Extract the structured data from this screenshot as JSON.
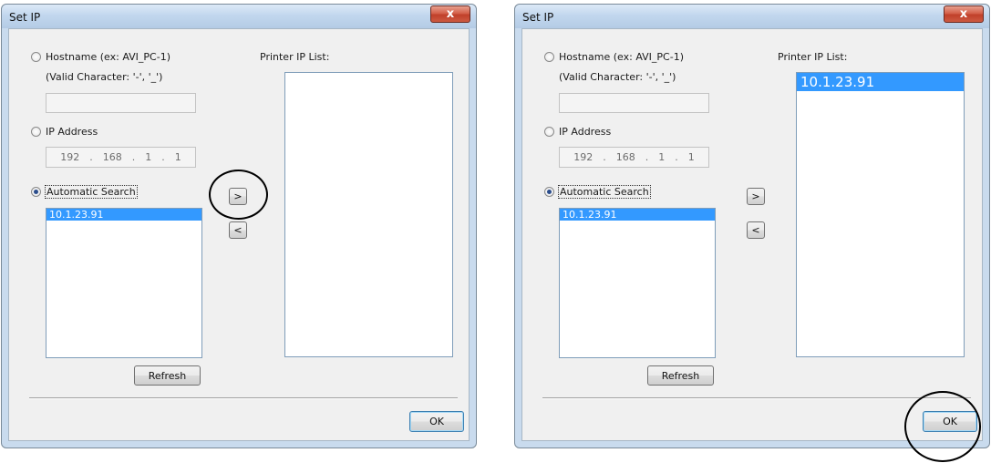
{
  "dialog": {
    "title": "Set IP",
    "close_label": "x",
    "hostname_radio_label": "Hostname (ex: AVI_PC-1)",
    "valid_chars_label": "(Valid Character: '-', '_')",
    "ip_radio_label": "IP Address",
    "ip_octets": [
      "192",
      "168",
      "1",
      "1"
    ],
    "ip_separator": ".",
    "auto_search_label": "Automatic Search",
    "printer_list_label": "Printer IP List:",
    "add_button": ">",
    "remove_button": "<",
    "refresh_button": "Refresh",
    "ok_button": "OK"
  },
  "before": {
    "search_results": [
      "10.1.23.91"
    ],
    "printer_ip_list": []
  },
  "after": {
    "search_results": [
      "10.1.23.91"
    ],
    "printer_ip_list": [
      "10.1.23.91"
    ]
  }
}
